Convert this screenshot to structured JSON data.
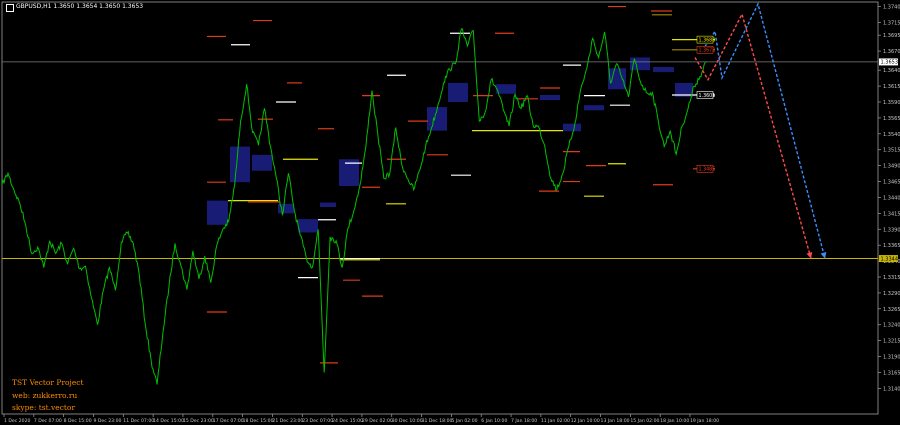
{
  "window": {
    "title": "GBPUSD,H1",
    "ohlc": "1.3650 1.3654 1.3650 1.3653"
  },
  "info_block": {
    "line1": "TST Vector Project",
    "line2": "web: zukkerro.ru",
    "line3": "skype: tst.vector"
  },
  "colors": {
    "background": "#000000",
    "candles": "#00c000",
    "axis": "#a0a0a0",
    "grid_text": "#c8c8c8",
    "zones": "#1a1e7a",
    "level_red": "#e03a1a",
    "level_white": "#ffffff",
    "level_yellow": "#e6e600",
    "level_olive": "#a08a00",
    "price_line": "#808080",
    "target_line": "#c8b400",
    "info_text": "#ff8c00"
  },
  "chart_data": {
    "type": "line",
    "series": [
      {
        "values": [
          1.346,
          1.3478,
          1.3452,
          1.343,
          1.3395,
          1.3352,
          1.3362,
          1.333,
          1.3372,
          1.3352,
          1.3368,
          1.3335,
          1.336,
          1.3328,
          1.3332,
          1.3282,
          1.324,
          1.3294,
          1.333,
          1.3294,
          1.337,
          1.3384,
          1.3368,
          1.332,
          1.3242,
          1.3183,
          1.3146,
          1.323,
          1.3302,
          1.3368,
          1.3332,
          1.3295,
          1.3356,
          1.3312,
          1.3348,
          1.3306,
          1.3365,
          1.339,
          1.3402,
          1.346,
          1.356,
          1.3618,
          1.3542,
          1.3522,
          1.358,
          1.352,
          1.347,
          1.3412,
          1.3478,
          1.342,
          1.338,
          1.3345,
          1.333,
          1.339,
          1.3165,
          1.3378,
          1.3372,
          1.333,
          1.3392,
          1.342,
          1.346,
          1.352,
          1.3608,
          1.3538,
          1.347,
          1.3478,
          1.355,
          1.3492,
          1.347,
          1.3452,
          1.3482,
          1.352,
          1.355,
          1.3582,
          1.362,
          1.3642,
          1.365,
          1.3705,
          1.3678,
          1.3702,
          1.356,
          1.3575,
          1.3625,
          1.361,
          1.3578,
          1.3552,
          1.3602,
          1.358,
          1.36,
          1.3554,
          1.355,
          1.352,
          1.347,
          1.3452,
          1.3478,
          1.352,
          1.3555,
          1.361,
          1.3642,
          1.369,
          1.366,
          1.37,
          1.362,
          1.365,
          1.3625,
          1.3598,
          1.3658,
          1.3622,
          1.3605,
          1.3605,
          1.356,
          1.352,
          1.3545,
          1.3508,
          1.3552,
          1.358,
          1.3615,
          1.363,
          1.3653
        ]
      }
    ],
    "x_tick_labels": [
      "1 Dec 2020",
      "7 Dec 07:00",
      "8 Dec 15:00",
      "9 Dec 23:00",
      "11 Dec 07:00",
      "14 Dec 15:00",
      "15 Dec 23:00",
      "17 Dec 07:00",
      "18 Dec 15:00",
      "21 Dec 23:00",
      "23 Dec 07:00",
      "24 Dec 15:00",
      "29 Dec 02:00",
      "30 Dec 10:00",
      "31 Dec 18:00",
      "5 Jan 02:00",
      "6 Jan 10:00",
      "7 Jan 18:00",
      "11 Jan 02:00",
      "12 Jan 10:00",
      "13 Jan 18:00",
      "15 Jan 02:00",
      "18 Jan 10:00",
      "19 Jan 18:00"
    ],
    "y_ticks": [
      1.374,
      1.3715,
      1.3695,
      1.367,
      1.364,
      1.3615,
      1.359,
      1.3565,
      1.354,
      1.3515,
      1.349,
      1.3465,
      1.344,
      1.3415,
      1.339,
      1.3365,
      1.334,
      1.3315,
      1.329,
      1.3265,
      1.324,
      1.3215,
      1.319,
      1.3165,
      1.314
    ],
    "ylim": [
      1.3128,
      1.3744
    ],
    "current_price": {
      "value": 1.3653,
      "label": "1.3653"
    },
    "target_line": {
      "value": 1.3344,
      "label": "1.3344"
    },
    "price_labels": [
      {
        "value": 1.3688,
        "text": "1.3688",
        "color": "#e6e600"
      },
      {
        "value": 1.3672,
        "text": "1.3672",
        "color": "#e03a1a"
      },
      {
        "value": 1.3601,
        "text": "1.3601",
        "color": "#ffffff"
      },
      {
        "value": 1.3485,
        "text": "1.3485",
        "color": "#e03a1a"
      }
    ],
    "zones": [
      {
        "x0": 230,
        "x1": 250,
        "y0": 1.352,
        "y1": 1.3464
      },
      {
        "x0": 252,
        "x1": 272,
        "y0": 1.3507,
        "y1": 1.3482
      },
      {
        "x0": 207,
        "x1": 228,
        "y0": 1.3435,
        "y1": 1.3397
      },
      {
        "x0": 278,
        "x1": 294,
        "y0": 1.343,
        "y1": 1.3415
      },
      {
        "x0": 298,
        "x1": 318,
        "y0": 1.3406,
        "y1": 1.3385
      },
      {
        "x0": 320,
        "x1": 336,
        "y0": 1.3432,
        "y1": 1.3425
      },
      {
        "x0": 339,
        "x1": 359,
        "y0": 1.35,
        "y1": 1.3458
      },
      {
        "x0": 427,
        "x1": 447,
        "y0": 1.3582,
        "y1": 1.3545
      },
      {
        "x0": 448,
        "x1": 468,
        "y0": 1.362,
        "y1": 1.359
      },
      {
        "x0": 496,
        "x1": 516,
        "y0": 1.3618,
        "y1": 1.3603
      },
      {
        "x0": 540,
        "x1": 560,
        "y0": 1.3601,
        "y1": 1.3593
      },
      {
        "x0": 563,
        "x1": 581,
        "y0": 1.3556,
        "y1": 1.3544
      },
      {
        "x0": 584,
        "x1": 604,
        "y0": 1.3585,
        "y1": 1.3577
      },
      {
        "x0": 608,
        "x1": 626,
        "y0": 1.3643,
        "y1": 1.361
      },
      {
        "x0": 630,
        "x1": 650,
        "y0": 1.366,
        "y1": 1.364
      },
      {
        "x0": 653,
        "x1": 674,
        "y0": 1.3645,
        "y1": 1.3637
      },
      {
        "x0": 675,
        "x1": 693,
        "y0": 1.362,
        "y1": 1.3598
      }
    ],
    "levels": [
      {
        "x0": 207,
        "x1": 226,
        "y": 1.3693,
        "c": "#e03a1a"
      },
      {
        "x0": 231,
        "x1": 250,
        "y": 1.368,
        "c": "#ffffff"
      },
      {
        "x0": 253,
        "x1": 272,
        "y": 1.3718,
        "c": "#e03a1a"
      },
      {
        "x0": 218,
        "x1": 233,
        "y": 1.3562,
        "c": "#e03a1a"
      },
      {
        "x0": 258,
        "x1": 273,
        "y": 1.3563,
        "c": "#e03a1a"
      },
      {
        "x0": 276,
        "x1": 296,
        "y": 1.359,
        "c": "#ffffff"
      },
      {
        "x0": 287,
        "x1": 302,
        "y": 1.362,
        "c": "#e03a1a"
      },
      {
        "x0": 207,
        "x1": 226,
        "y": 1.3464,
        "c": "#e03a1a"
      },
      {
        "x0": 228,
        "x1": 278,
        "y": 1.3435,
        "c": "#e6e600"
      },
      {
        "x0": 248,
        "x1": 280,
        "y": 1.3433,
        "c": "#e03a1a"
      },
      {
        "x0": 283,
        "x1": 318,
        "y": 1.35,
        "c": "#e6e600"
      },
      {
        "x0": 345,
        "x1": 362,
        "y": 1.3494,
        "c": "#ffffff"
      },
      {
        "x0": 318,
        "x1": 334,
        "y": 1.3548,
        "c": "#e03a1a"
      },
      {
        "x0": 318,
        "x1": 336,
        "y": 1.3405,
        "c": "#ffffff"
      },
      {
        "x0": 340,
        "x1": 380,
        "y": 1.3344,
        "c": "#ffffff"
      },
      {
        "x0": 340,
        "x1": 380,
        "y": 1.3342,
        "c": "#e6e600"
      },
      {
        "x0": 298,
        "x1": 318,
        "y": 1.3314,
        "c": "#ffffff"
      },
      {
        "x0": 343,
        "x1": 360,
        "y": 1.331,
        "c": "#e03a1a"
      },
      {
        "x0": 362,
        "x1": 383,
        "y": 1.3285,
        "c": "#e03a1a"
      },
      {
        "x0": 207,
        "x1": 227,
        "y": 1.326,
        "c": "#e03a1a"
      },
      {
        "x0": 320,
        "x1": 338,
        "y": 1.318,
        "c": "#e03a1a"
      },
      {
        "x0": 362,
        "x1": 380,
        "y": 1.36,
        "c": "#e03a1a"
      },
      {
        "x0": 387,
        "x1": 406,
        "y": 1.3632,
        "c": "#ffffff"
      },
      {
        "x0": 387,
        "x1": 406,
        "y": 1.35,
        "c": "#e03a1a"
      },
      {
        "x0": 386,
        "x1": 406,
        "y": 1.343,
        "c": "#e6e600"
      },
      {
        "x0": 362,
        "x1": 380,
        "y": 1.3456,
        "c": "#e03a1a"
      },
      {
        "x0": 408,
        "x1": 428,
        "y": 1.356,
        "c": "#e03a1a"
      },
      {
        "x0": 427,
        "x1": 448,
        "y": 1.3507,
        "c": "#e03a1a"
      },
      {
        "x0": 450,
        "x1": 470,
        "y": 1.3698,
        "c": "#ffffff"
      },
      {
        "x0": 451,
        "x1": 471,
        "y": 1.3475,
        "c": "#ffffff"
      },
      {
        "x0": 472,
        "x1": 563,
        "y": 1.3545,
        "c": "#e6e600"
      },
      {
        "x0": 473,
        "x1": 493,
        "y": 1.36,
        "c": "#e03a1a"
      },
      {
        "x0": 495,
        "x1": 514,
        "y": 1.3698,
        "c": "#e03a1a"
      },
      {
        "x0": 518,
        "x1": 538,
        "y": 1.3595,
        "c": "#e03a1a"
      },
      {
        "x0": 540,
        "x1": 560,
        "y": 1.3612,
        "c": "#e03a1a"
      },
      {
        "x0": 539,
        "x1": 559,
        "y": 1.345,
        "c": "#e03a1a"
      },
      {
        "x0": 563,
        "x1": 581,
        "y": 1.3648,
        "c": "#ffffff"
      },
      {
        "x0": 563,
        "x1": 580,
        "y": 1.3512,
        "c": "#e03a1a"
      },
      {
        "x0": 563,
        "x1": 580,
        "y": 1.3465,
        "c": "#e03a1a"
      },
      {
        "x0": 584,
        "x1": 604,
        "y": 1.3442,
        "c": "#e6e600"
      },
      {
        "x0": 584,
        "x1": 605,
        "y": 1.36,
        "c": "#ffffff"
      },
      {
        "x0": 586,
        "x1": 606,
        "y": 1.349,
        "c": "#e03a1a"
      },
      {
        "x0": 608,
        "x1": 626,
        "y": 1.374,
        "c": "#e03a1a"
      },
      {
        "x0": 608,
        "x1": 626,
        "y": 1.3493,
        "c": "#e6e600"
      },
      {
        "x0": 610,
        "x1": 630,
        "y": 1.3585,
        "c": "#ffffff"
      },
      {
        "x0": 651,
        "x1": 672,
        "y": 1.3733,
        "c": "#e03a1a"
      },
      {
        "x0": 652,
        "x1": 672,
        "y": 1.3727,
        "c": "#a08a00"
      },
      {
        "x0": 653,
        "x1": 673,
        "y": 1.346,
        "c": "#e03a1a"
      },
      {
        "x0": 672,
        "x1": 715,
        "y": 1.3688,
        "c": "#e6e600"
      },
      {
        "x0": 672,
        "x1": 715,
        "y": 1.3672,
        "c": "#a08a00"
      },
      {
        "x0": 672,
        "x1": 715,
        "y": 1.3601,
        "c": "#ffffff"
      },
      {
        "x0": 693,
        "x1": 715,
        "y": 1.3485,
        "c": "#e03a1a"
      }
    ],
    "arrows": [
      {
        "color": "#ff4a4a",
        "points": [
          [
            695,
            1.366
          ],
          [
            708,
            1.3625
          ],
          [
            742,
            1.3728
          ],
          [
            811,
            1.3344
          ]
        ]
      },
      {
        "color": "#3a8fff",
        "points": [
          [
            702,
            1.367
          ],
          [
            715,
            1.3701
          ],
          [
            722,
            1.3628
          ],
          [
            758,
            1.3744
          ],
          [
            825,
            1.3344
          ]
        ]
      }
    ]
  }
}
